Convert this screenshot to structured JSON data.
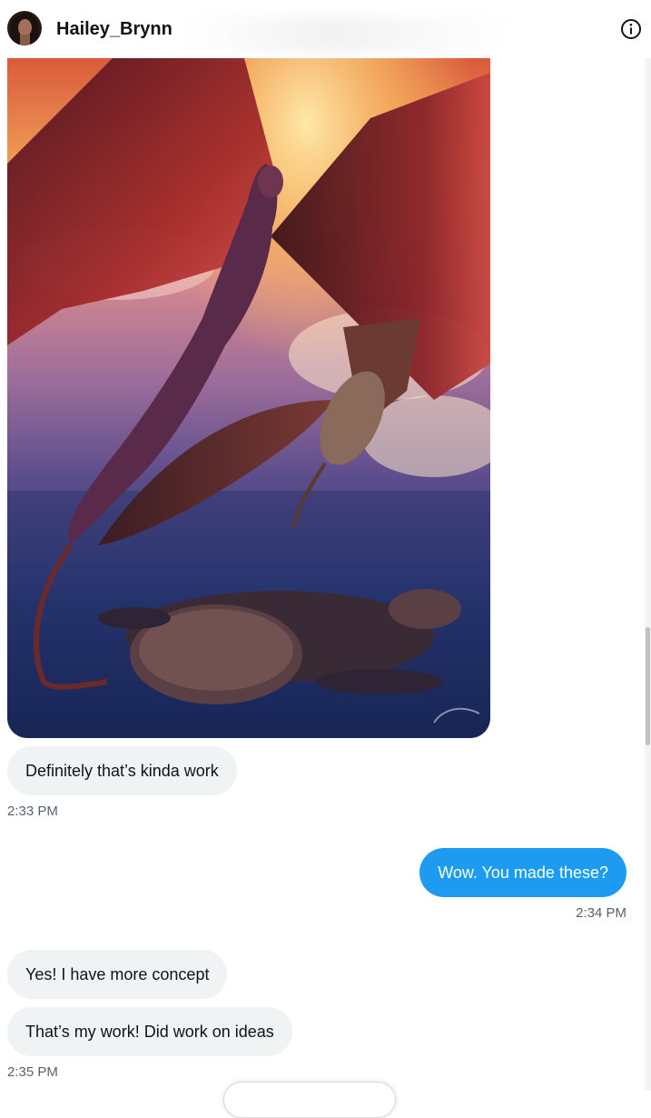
{
  "header": {
    "username": "Hailey_Brynn",
    "info_icon": "info-circle-icon"
  },
  "messages": [
    {
      "type": "image",
      "direction": "received",
      "subject": "winged-creatures-artwork"
    },
    {
      "type": "text",
      "direction": "received",
      "text": "Definitely that’s kinda work"
    },
    {
      "type": "time",
      "direction": "received",
      "text": "2:33 PM"
    },
    {
      "type": "text",
      "direction": "sent",
      "text": "Wow. You made these?"
    },
    {
      "type": "time",
      "direction": "sent",
      "text": "2:34 PM"
    },
    {
      "type": "text",
      "direction": "received",
      "text": "Yes! I have more concept"
    },
    {
      "type": "text",
      "direction": "received",
      "text": "That’s my work! Did work on ideas"
    },
    {
      "type": "time",
      "direction": "received",
      "text": "2:35 PM"
    }
  ],
  "colors": {
    "sent_bubble": "#1d9bf0",
    "received_bubble": "#eff3f4",
    "timestamp": "#536471"
  }
}
